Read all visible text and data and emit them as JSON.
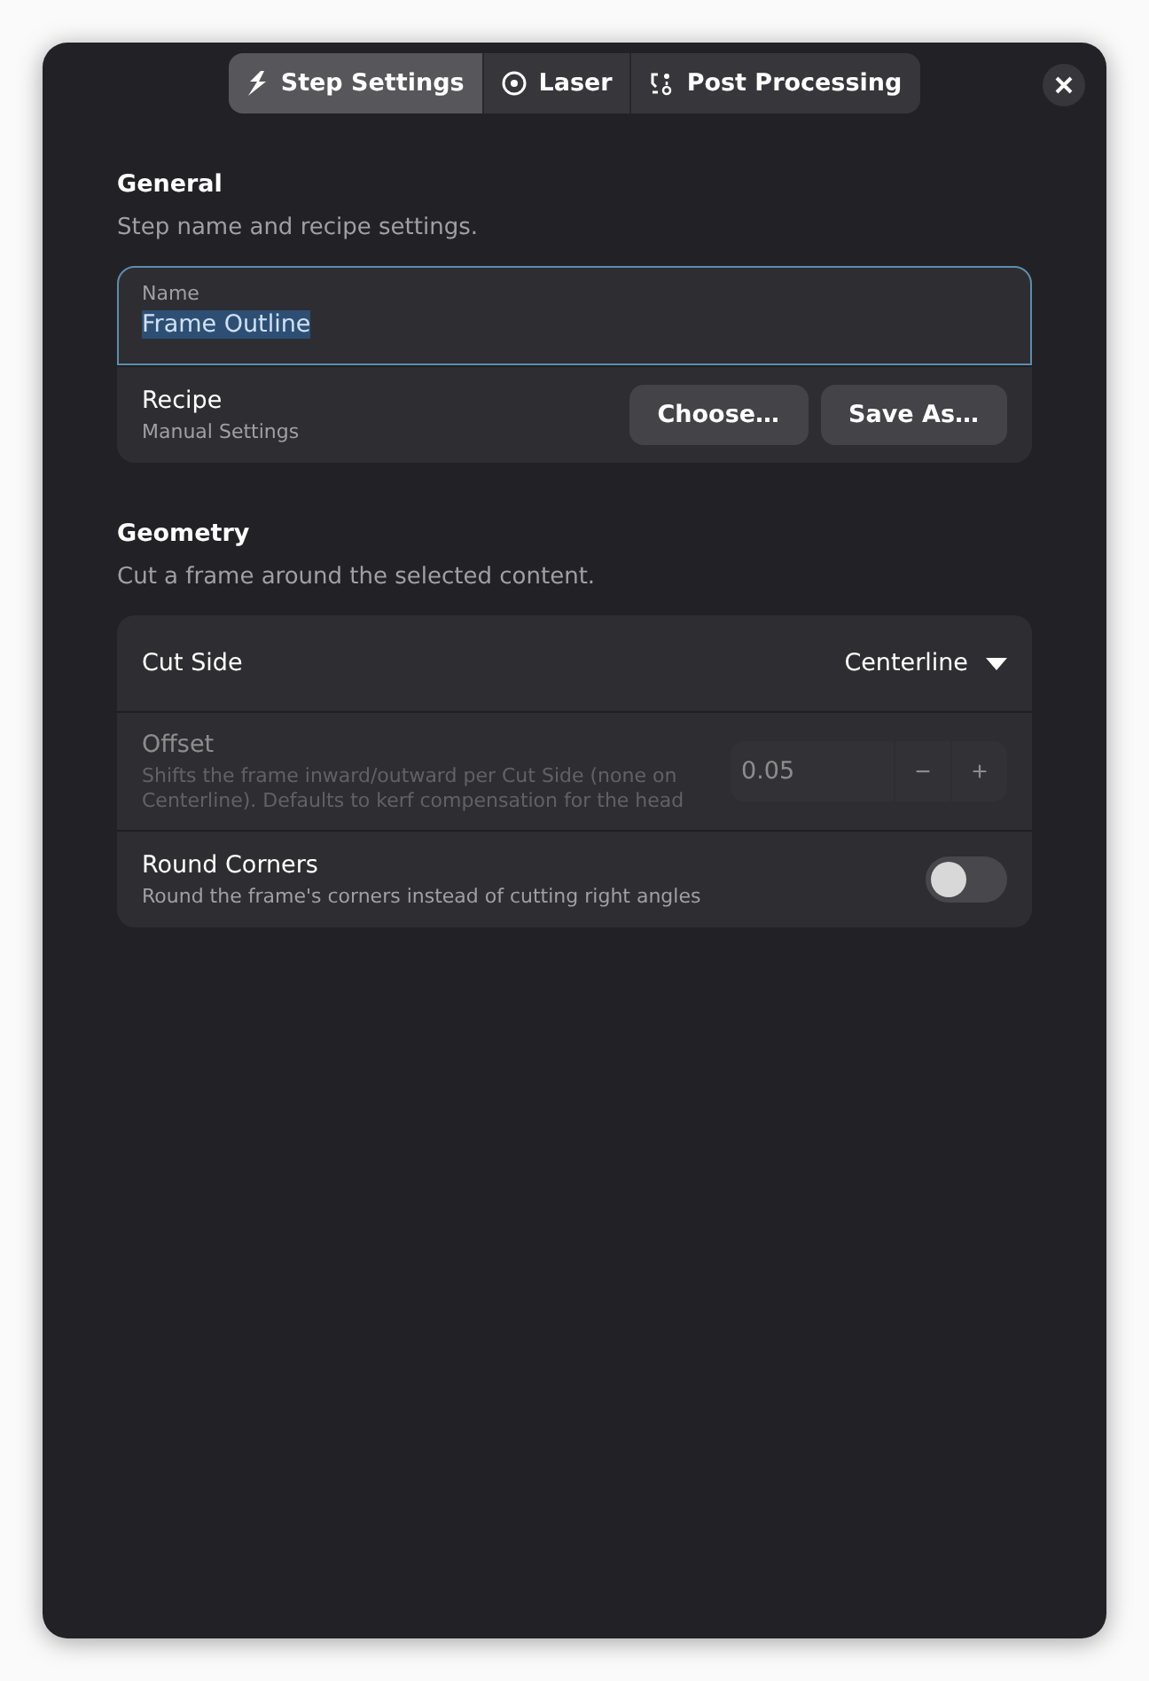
{
  "tabs": [
    {
      "label": "Step Settings",
      "selected": true
    },
    {
      "label": "Laser",
      "selected": false
    },
    {
      "label": "Post Processing",
      "selected": false
    }
  ],
  "sections": [
    {
      "title": "General",
      "subtitle": "Step name and recipe settings.",
      "name_field": {
        "label": "Name",
        "value": "Frame Outline",
        "focused": true,
        "text_selected": true
      },
      "rows": [
        {
          "kind": "buttons",
          "title": "Recipe",
          "subtitle": "Manual Settings",
          "disabled": false,
          "buttons": [
            "Choose…",
            "Save As…"
          ]
        }
      ]
    },
    {
      "title": "Geometry",
      "subtitle": "Cut a frame around the selected content.",
      "rows": [
        {
          "kind": "dropdown",
          "title": "Cut Side",
          "disabled": false,
          "value": "Centerline"
        },
        {
          "kind": "spin",
          "title": "Offset",
          "subtitle": "Shifts the frame inward/outward per Cut Side (none on Centerline). Defaults to kerf compensation for the head",
          "disabled": true,
          "value": "0.05",
          "minus": "−",
          "plus": "+"
        },
        {
          "kind": "switch",
          "title": "Round Corners",
          "subtitle": "Round the frame's corners instead of cutting right angles",
          "disabled": false,
          "on": false
        }
      ]
    }
  ]
}
